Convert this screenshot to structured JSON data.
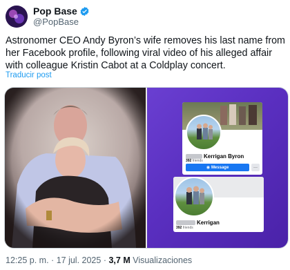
{
  "author": {
    "display_name": "Pop Base",
    "handle": "@PopBase",
    "verified_color": "#1d9bf0"
  },
  "tweet": {
    "text": "Astronomer CEO Andy Byron’s wife removes his last name from her Facebook profile, following viral video of his alleged affair with colleague Kristin Cabot at a Coldplay concert.",
    "translate_label": "Traducir post"
  },
  "media": {
    "profile_before": {
      "name": "Kerrigan Byron",
      "friends_count": "392",
      "friends_label": "friends",
      "message_button": "Message",
      "more_button": "···"
    },
    "profile_after": {
      "name": "Kerrigan",
      "friends_count": "392",
      "friends_label": "friends"
    }
  },
  "meta": {
    "time": "12:25 p. m.",
    "separator": "·",
    "date": "17 jul. 2025",
    "views_count": "3,7 M",
    "views_label": "Visualizaciones"
  }
}
